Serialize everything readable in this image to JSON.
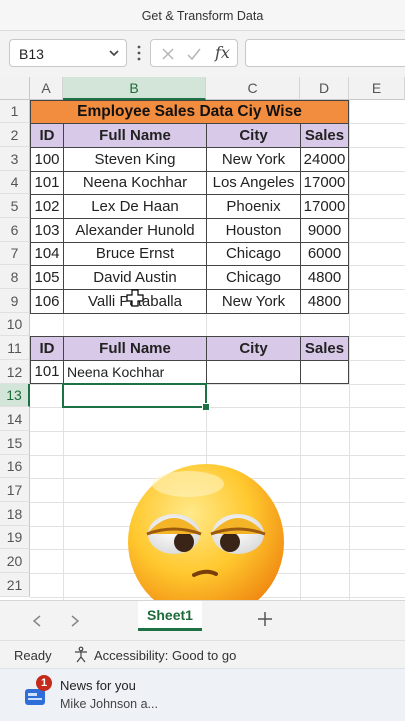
{
  "ribbon": {
    "group_label": "Get & Transform Data"
  },
  "formula_bar": {
    "name_box": "B13",
    "fx_label": "fx",
    "formula": ""
  },
  "columns": [
    "A",
    "B",
    "C",
    "D",
    "E"
  ],
  "rows": [
    "1",
    "2",
    "3",
    "4",
    "5",
    "6",
    "7",
    "8",
    "9",
    "10",
    "11",
    "12",
    "13",
    "14",
    "15",
    "16",
    "17",
    "18",
    "19",
    "20",
    "21"
  ],
  "table1": {
    "title": "Employee Sales Data Ciy Wise",
    "headers": [
      "ID",
      "Full Name",
      "City",
      "Sales"
    ],
    "rows": [
      [
        "100",
        "Steven King",
        "New York",
        "24000"
      ],
      [
        "101",
        "Neena Kochhar",
        "Los Angeles",
        "17000"
      ],
      [
        "102",
        "Lex De Haan",
        "Phoenix",
        "17000"
      ],
      [
        "103",
        "Alexander Hunold",
        "Houston",
        "9000"
      ],
      [
        "104",
        "Bruce Ernst",
        "Chicago",
        "6000"
      ],
      [
        "105",
        "David Austin",
        "Chicago",
        "4800"
      ],
      [
        "106",
        "Valli Pataballa",
        "New York",
        "4800"
      ]
    ]
  },
  "table2": {
    "headers": [
      "ID",
      "Full Name",
      "City",
      "Sales"
    ],
    "row": [
      "101",
      "Neena Kochhar",
      "",
      ""
    ]
  },
  "colors": {
    "title_fill": "#f28c3e",
    "header_fill": "#d9c9e8",
    "excel_green": "#1e7145"
  },
  "sheet_tabs": {
    "active": "Sheet1",
    "add_icon": "plus-icon"
  },
  "status_bar": {
    "ready": "Ready",
    "accessibility": "Accessibility: Good to go"
  },
  "taskbar": {
    "news_badge": "1",
    "news_title": "News for you",
    "news_sub": "Mike Johnson a..."
  }
}
